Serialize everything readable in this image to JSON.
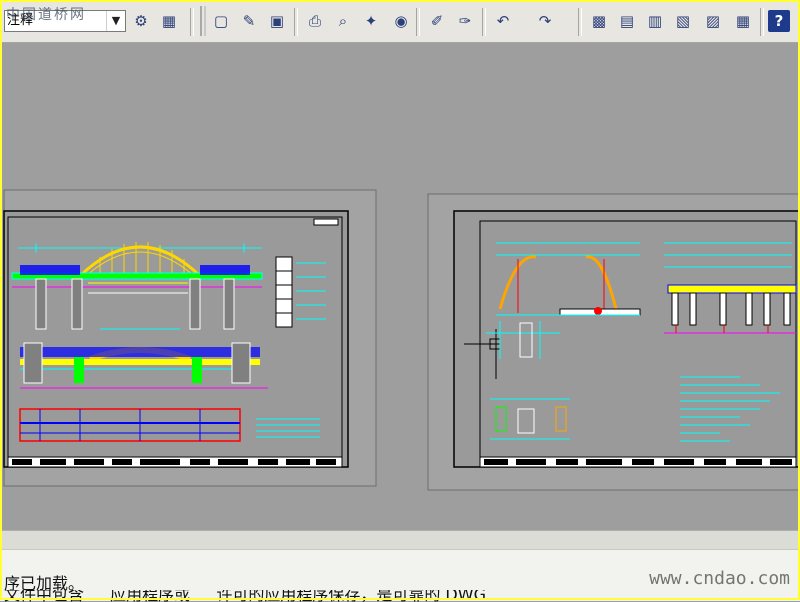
{
  "toolbar": {
    "layer_combo_value": "注释",
    "buttons": [
      {
        "name": "named-views-icon",
        "glyph": "⚙"
      },
      {
        "name": "properties-icon",
        "glyph": "▦"
      },
      {
        "name": "new-file-icon",
        "glyph": "▢"
      },
      {
        "name": "open-file-icon",
        "glyph": "✎"
      },
      {
        "name": "save-icon",
        "glyph": "▣"
      },
      {
        "name": "print-icon",
        "glyph": "⎙"
      },
      {
        "name": "print-preview-icon",
        "glyph": "⌕"
      },
      {
        "name": "publish-icon",
        "glyph": "✦"
      },
      {
        "name": "publish-web-icon",
        "glyph": "◉"
      },
      {
        "name": "match-properties-icon",
        "glyph": "✐"
      },
      {
        "name": "paintbrush-icon",
        "glyph": "✑"
      },
      {
        "name": "undo-icon",
        "glyph": "↶"
      },
      {
        "name": "redo-icon",
        "glyph": "↷"
      },
      {
        "name": "design-center-icon",
        "glyph": "▩"
      },
      {
        "name": "tool-palettes-icon",
        "glyph": "▤"
      },
      {
        "name": "sheet-set-icon",
        "glyph": "▥"
      },
      {
        "name": "markup-icon",
        "glyph": "▧"
      },
      {
        "name": "quickcalc-icon",
        "glyph": "▨"
      },
      {
        "name": "calculator-icon",
        "glyph": "▦"
      },
      {
        "name": "help-icon",
        "glyph": "?"
      }
    ]
  },
  "watermark_top": "中国道桥网",
  "watermark_bottom": "www.cndao.com",
  "command_line": {
    "line1": "序已加载。",
    "line2": "文件中包含 … 应用程序或 … 许可的应用程序保存，是可靠的 DWG"
  },
  "colors": {
    "frame": "#ffff33",
    "canvas": "#9e9e9e",
    "paper": "#a8a8a8",
    "drawing_bg": "#9a9a9a"
  }
}
